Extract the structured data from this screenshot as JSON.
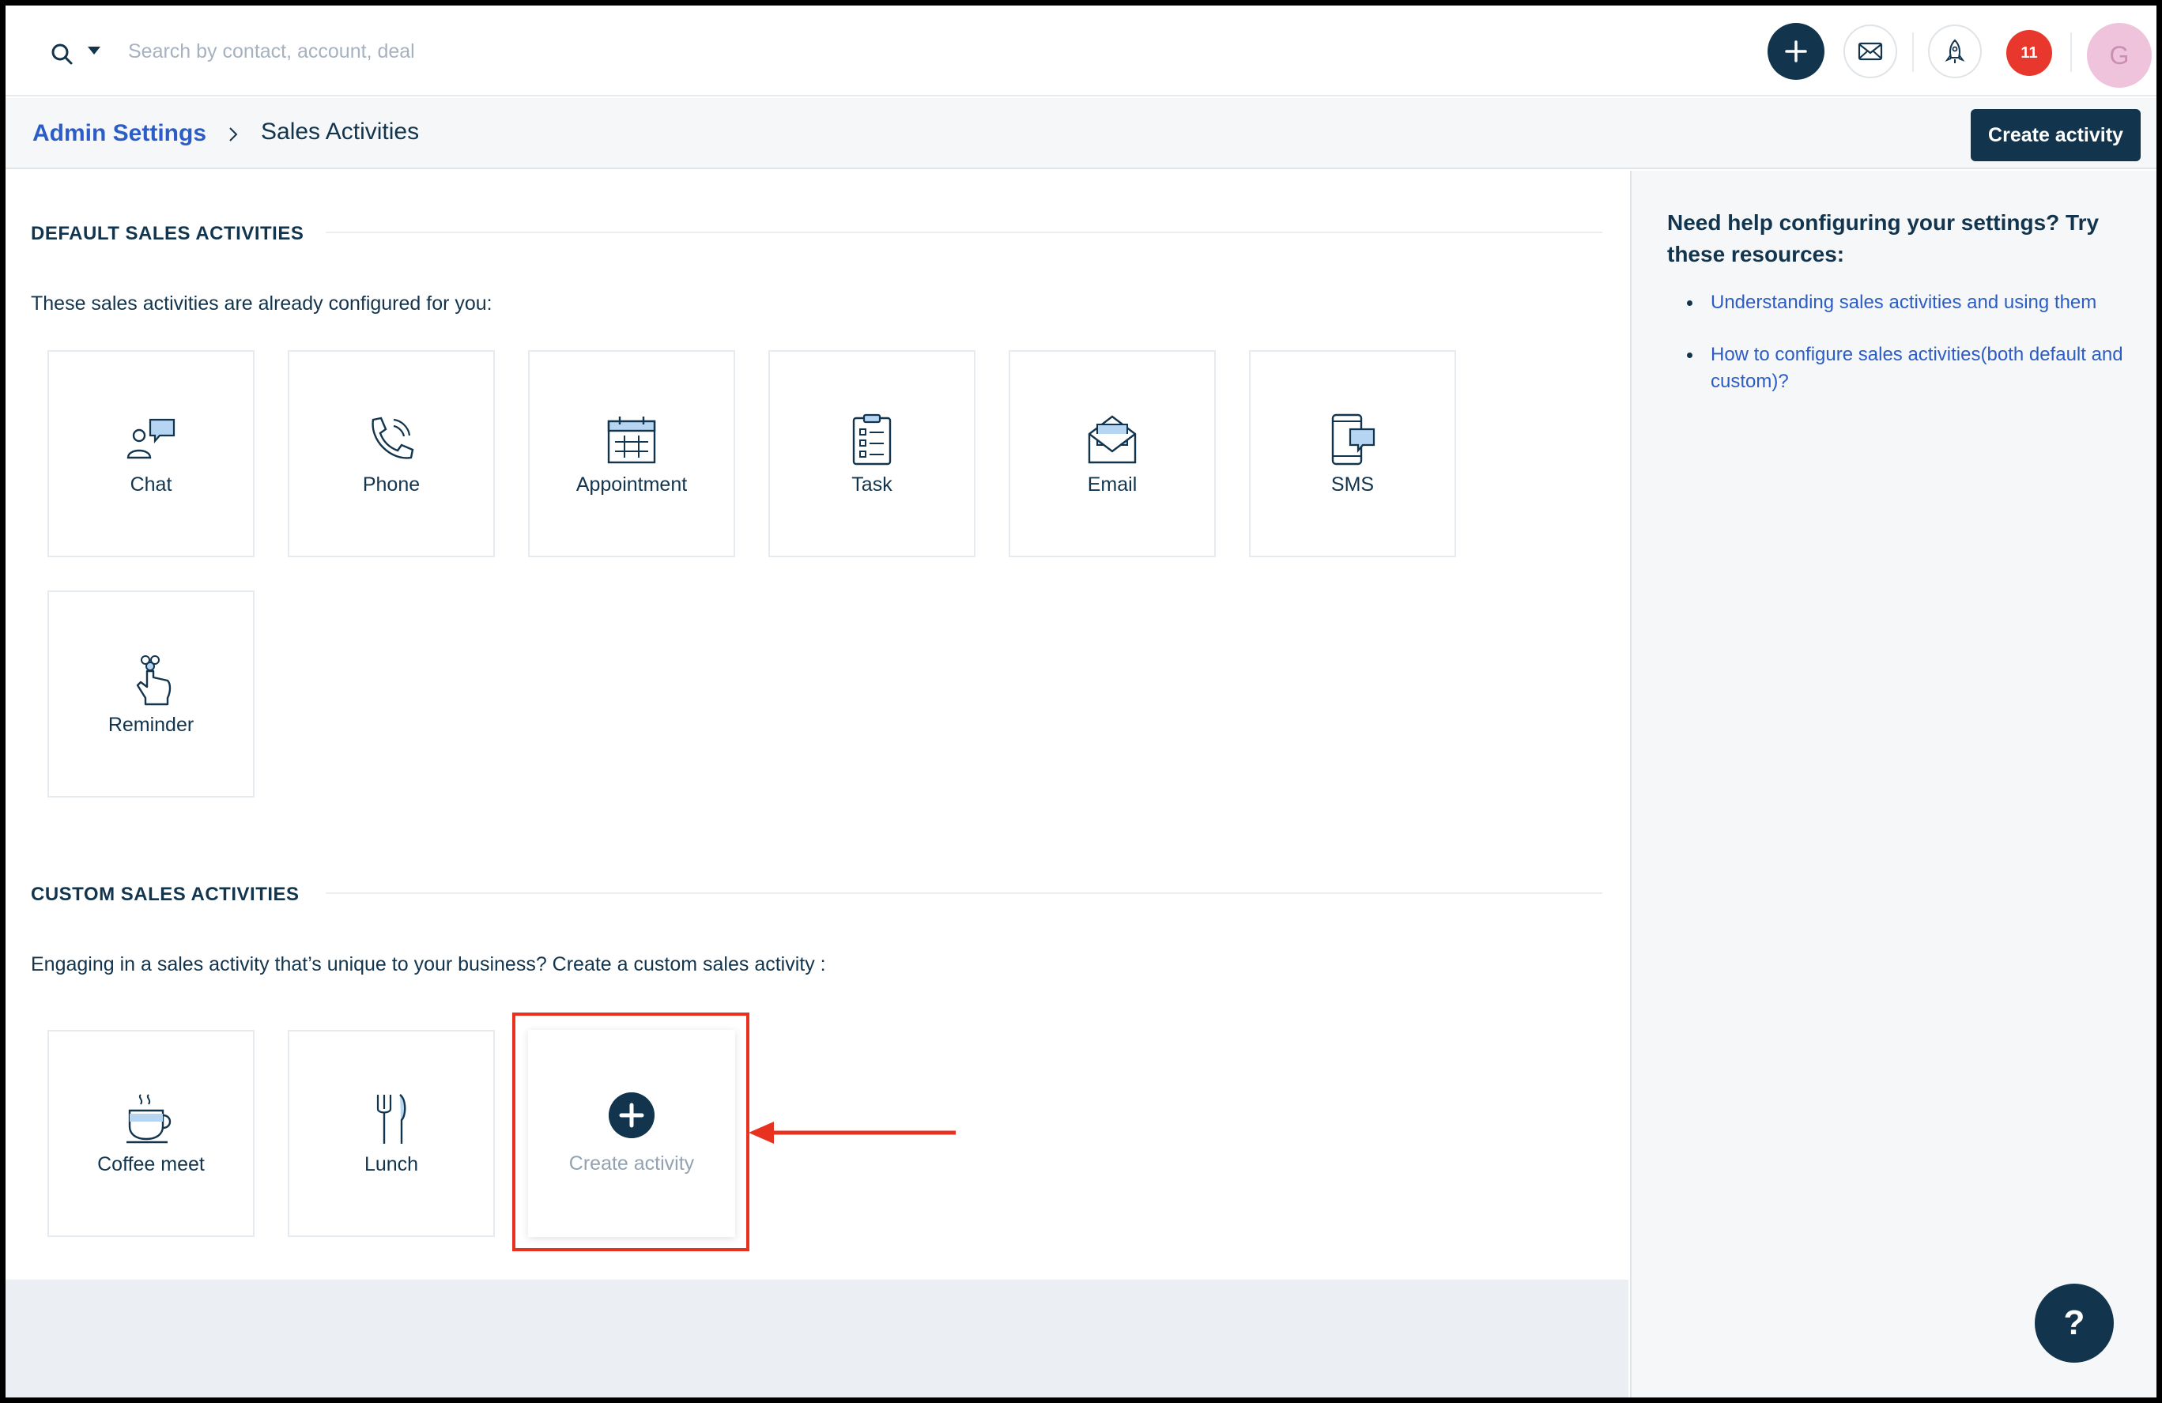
{
  "topbar": {
    "search_placeholder": "Search by contact, account, deal",
    "notification_count": "11",
    "avatar_initial": "G"
  },
  "breadcrumb": {
    "parent": "Admin Settings",
    "current": "Sales Activities",
    "create_button": "Create activity"
  },
  "default_section": {
    "title": "DEFAULT SALES ACTIVITIES",
    "description": "These sales activities are already configured for you:",
    "items": [
      {
        "label": "Chat",
        "icon": "chat-icon"
      },
      {
        "label": "Phone",
        "icon": "phone-icon"
      },
      {
        "label": "Appointment",
        "icon": "calendar-icon"
      },
      {
        "label": "Task",
        "icon": "task-icon"
      },
      {
        "label": "Email",
        "icon": "email-icon"
      },
      {
        "label": "SMS",
        "icon": "sms-icon"
      },
      {
        "label": "Reminder",
        "icon": "reminder-icon"
      }
    ]
  },
  "custom_section": {
    "title": "CUSTOM SALES ACTIVITIES",
    "description": "Engaging in a sales activity that’s unique to your business? Create a custom sales activity :",
    "items": [
      {
        "label": "Coffee meet",
        "icon": "coffee-icon"
      },
      {
        "label": "Lunch",
        "icon": "cutlery-icon"
      }
    ],
    "create_label": "Create activity"
  },
  "sidebar": {
    "title": "Need help configuring your settings? Try these resources:",
    "links": [
      "Understanding sales activities and using them",
      "How to configure sales activities(both default and custom)?"
    ]
  },
  "help_button": "?",
  "colors": {
    "primary": "#12344d",
    "link": "#2c5cc5",
    "notification": "#e8372c",
    "highlight": "#e8321f"
  }
}
